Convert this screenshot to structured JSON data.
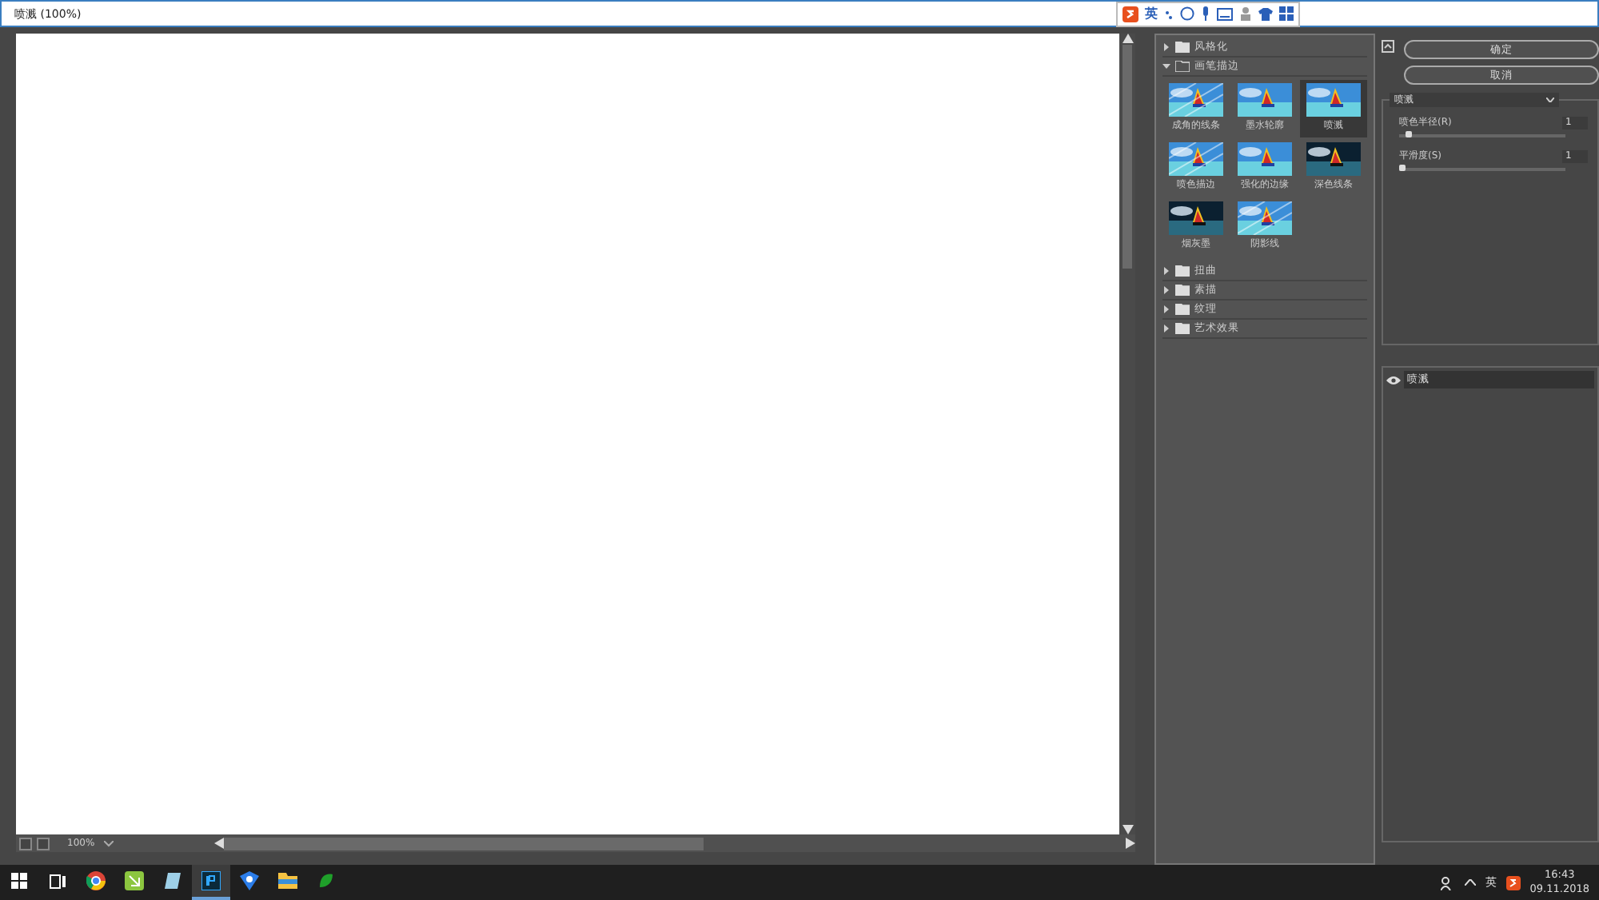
{
  "window": {
    "title": "喷溅 (100%)"
  },
  "ime_toolbar": {
    "language": "英"
  },
  "canvas": {
    "zoom": "100%"
  },
  "filter_categories": [
    {
      "label": "风格化",
      "expanded": false
    },
    {
      "label": "画笔描边",
      "expanded": true,
      "filters": [
        {
          "label": "成角的线条",
          "selected": false
        },
        {
          "label": "墨水轮廓",
          "selected": false
        },
        {
          "label": "喷溅",
          "selected": true
        },
        {
          "label": "喷色描边",
          "selected": false
        },
        {
          "label": "强化的边缘",
          "selected": false
        },
        {
          "label": "深色线条",
          "selected": false
        },
        {
          "label": "烟灰墨",
          "selected": false
        },
        {
          "label": "阴影线",
          "selected": false
        }
      ]
    },
    {
      "label": "扭曲",
      "expanded": false
    },
    {
      "label": "素描",
      "expanded": false
    },
    {
      "label": "纹理",
      "expanded": false
    },
    {
      "label": "艺术效果",
      "expanded": false
    }
  ],
  "buttons": [
    "确定",
    "取消"
  ],
  "filter_select": {
    "value": "喷溅"
  },
  "parameters": [
    {
      "label": "喷色半径(R)",
      "value": "1",
      "level": 0.04
    },
    {
      "label": "平滑度(S)",
      "value": "1",
      "level": 0.0
    }
  ],
  "effect_layers": [
    {
      "label": "喷溅",
      "visible": true
    }
  ],
  "taskbar": {
    "apps": [
      {
        "kind": "chrome",
        "selected": false
      },
      {
        "kind": "green",
        "selected": false
      },
      {
        "kind": "glass",
        "selected": false
      },
      {
        "kind": "ps",
        "selected": true
      },
      {
        "kind": "shield",
        "selected": false
      },
      {
        "kind": "folder",
        "selected": false
      },
      {
        "kind": "leaf",
        "selected": false
      }
    ],
    "language": "英",
    "time": "16:43",
    "date": "09.11.2018"
  }
}
